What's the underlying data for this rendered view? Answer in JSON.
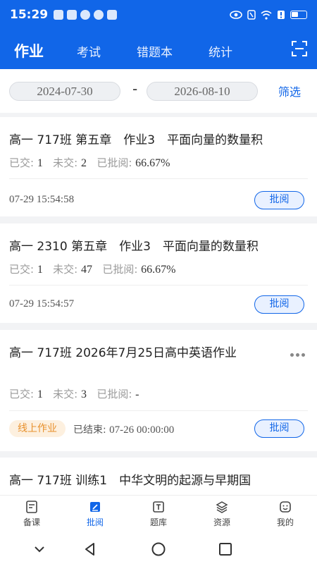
{
  "status_bar": {
    "time": "15:29"
  },
  "tabs": [
    {
      "label": "作业",
      "active": true
    },
    {
      "label": "考试",
      "active": false
    },
    {
      "label": "错题本",
      "active": false
    },
    {
      "label": "统计",
      "active": false
    }
  ],
  "filter": {
    "start_date": "2024-07-30",
    "separator": "-",
    "end_date": "2026-08-10",
    "filter_label": "筛选"
  },
  "stat_labels": {
    "submitted": "已交:",
    "unsubmitted": "未交:",
    "reviewed": "已批阅:"
  },
  "assignments": [
    {
      "title": "高一 717班 第五章　作业3　平面向量的数量积",
      "submitted": "1",
      "unsubmitted": "2",
      "reviewed": "66.67%",
      "time": "07-29 15:54:58",
      "action": "批阅"
    },
    {
      "title": "高一 2310 第五章　作业3　平面向量的数量积",
      "submitted": "1",
      "unsubmitted": "47",
      "reviewed": "66.67%",
      "time": "07-29 15:54:57",
      "action": "批阅"
    },
    {
      "title": "高一 717班 2026年7月25日高中英语作业",
      "submitted": "1",
      "unsubmitted": "3",
      "reviewed": "-",
      "tag": "线上作业",
      "ended_label": "已结束:",
      "ended_time": "07-26 00:00:00",
      "action": "批阅"
    },
    {
      "title": "高一 717班 训练1　中华文明的起源与早期国家"
    }
  ],
  "bottom_nav": [
    {
      "label": "备课",
      "icon": "lesson-prep-icon",
      "active": false
    },
    {
      "label": "批阅",
      "icon": "review-icon",
      "active": true
    },
    {
      "label": "题库",
      "icon": "question-bank-icon",
      "active": false
    },
    {
      "label": "资源",
      "icon": "resources-icon",
      "active": false
    },
    {
      "label": "我的",
      "icon": "profile-icon",
      "active": false
    }
  ],
  "colors": {
    "primary": "#1166e8",
    "tag_orange": "#e8912d",
    "tag_bg": "#fdf0df"
  }
}
